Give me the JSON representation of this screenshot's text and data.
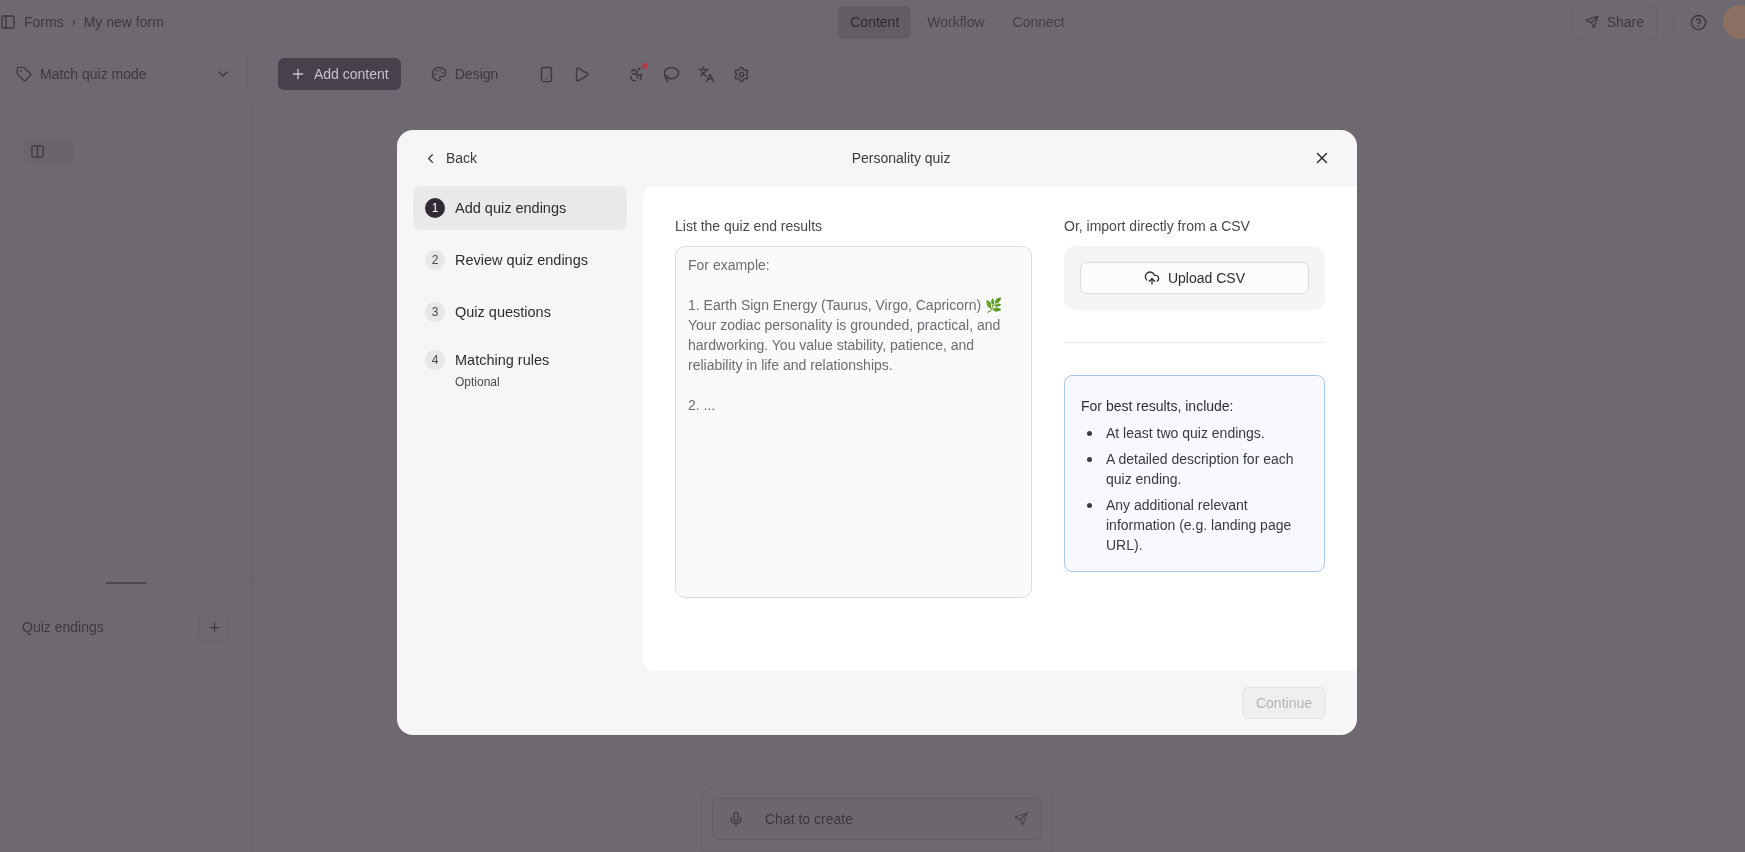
{
  "breadcrumb": [
    "Forms",
    "My new form"
  ],
  "breadcrumb_separator": "›",
  "nav_tabs": [
    {
      "label": "Content",
      "selected": true
    },
    {
      "label": "Workflow",
      "selected": false
    },
    {
      "label": "Connect",
      "selected": false
    }
  ],
  "share_button": "Share",
  "mode_dropdown": "Match quiz mode",
  "add_content_button": "Add content",
  "design_button": "Design",
  "notification_dot": true,
  "sidebar": {
    "section_title": "Quiz endings"
  },
  "chat": {
    "placeholder": "Chat to create"
  },
  "modal": {
    "back": "Back",
    "title": "Personality quiz",
    "steps": [
      {
        "number": "1",
        "label": "Add quiz endings",
        "selected": true
      },
      {
        "number": "2",
        "label": "Review quiz endings",
        "selected": false
      },
      {
        "number": "3",
        "label": "Quiz questions",
        "selected": false
      },
      {
        "number": "4",
        "label": "Matching rules",
        "sublabel": "Optional",
        "selected": false
      }
    ],
    "results_label": "List the quiz end results",
    "results_placeholder": "For example:\n\n1. Earth Sign Energy (Taurus, Virgo, Capricorn) 🌿\nYour zodiac personality is grounded, practical, and hardworking. You value stability, patience, and reliability in life and relationships.\n\n2. ...",
    "import_label": "Or, import directly from a CSV",
    "upload_button": "Upload CSV",
    "tips_title": "For best results, include:",
    "tips": [
      "At least two quiz endings.",
      "A detailed description for each quiz ending.",
      "Any additional relevant information (e.g. landing page URL)."
    ],
    "continue_button": {
      "label": "Continue",
      "disabled": true
    }
  }
}
